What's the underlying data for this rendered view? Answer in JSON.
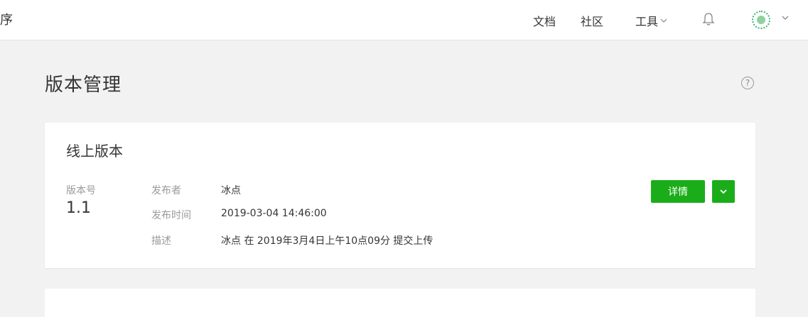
{
  "header": {
    "brand_fragment": "序",
    "nav": {
      "docs": "文档",
      "community": "社区",
      "tools": "工具"
    }
  },
  "page": {
    "title": "版本管理",
    "help": "?"
  },
  "online_version": {
    "section_title": "线上版本",
    "version_label": "版本号",
    "version_value": "1.1",
    "publisher_label": "发布者",
    "publisher_value": "冰点",
    "publish_time_label": "发布时间",
    "publish_time_value": "2019-03-04 14:46:00",
    "description_label": "描述",
    "description_value": "冰点 在 2019年3月4日上午10点09分 提交上传",
    "detail_button": "详情"
  },
  "colors": {
    "accent": "#1aad19",
    "background": "#f2f2f2"
  }
}
